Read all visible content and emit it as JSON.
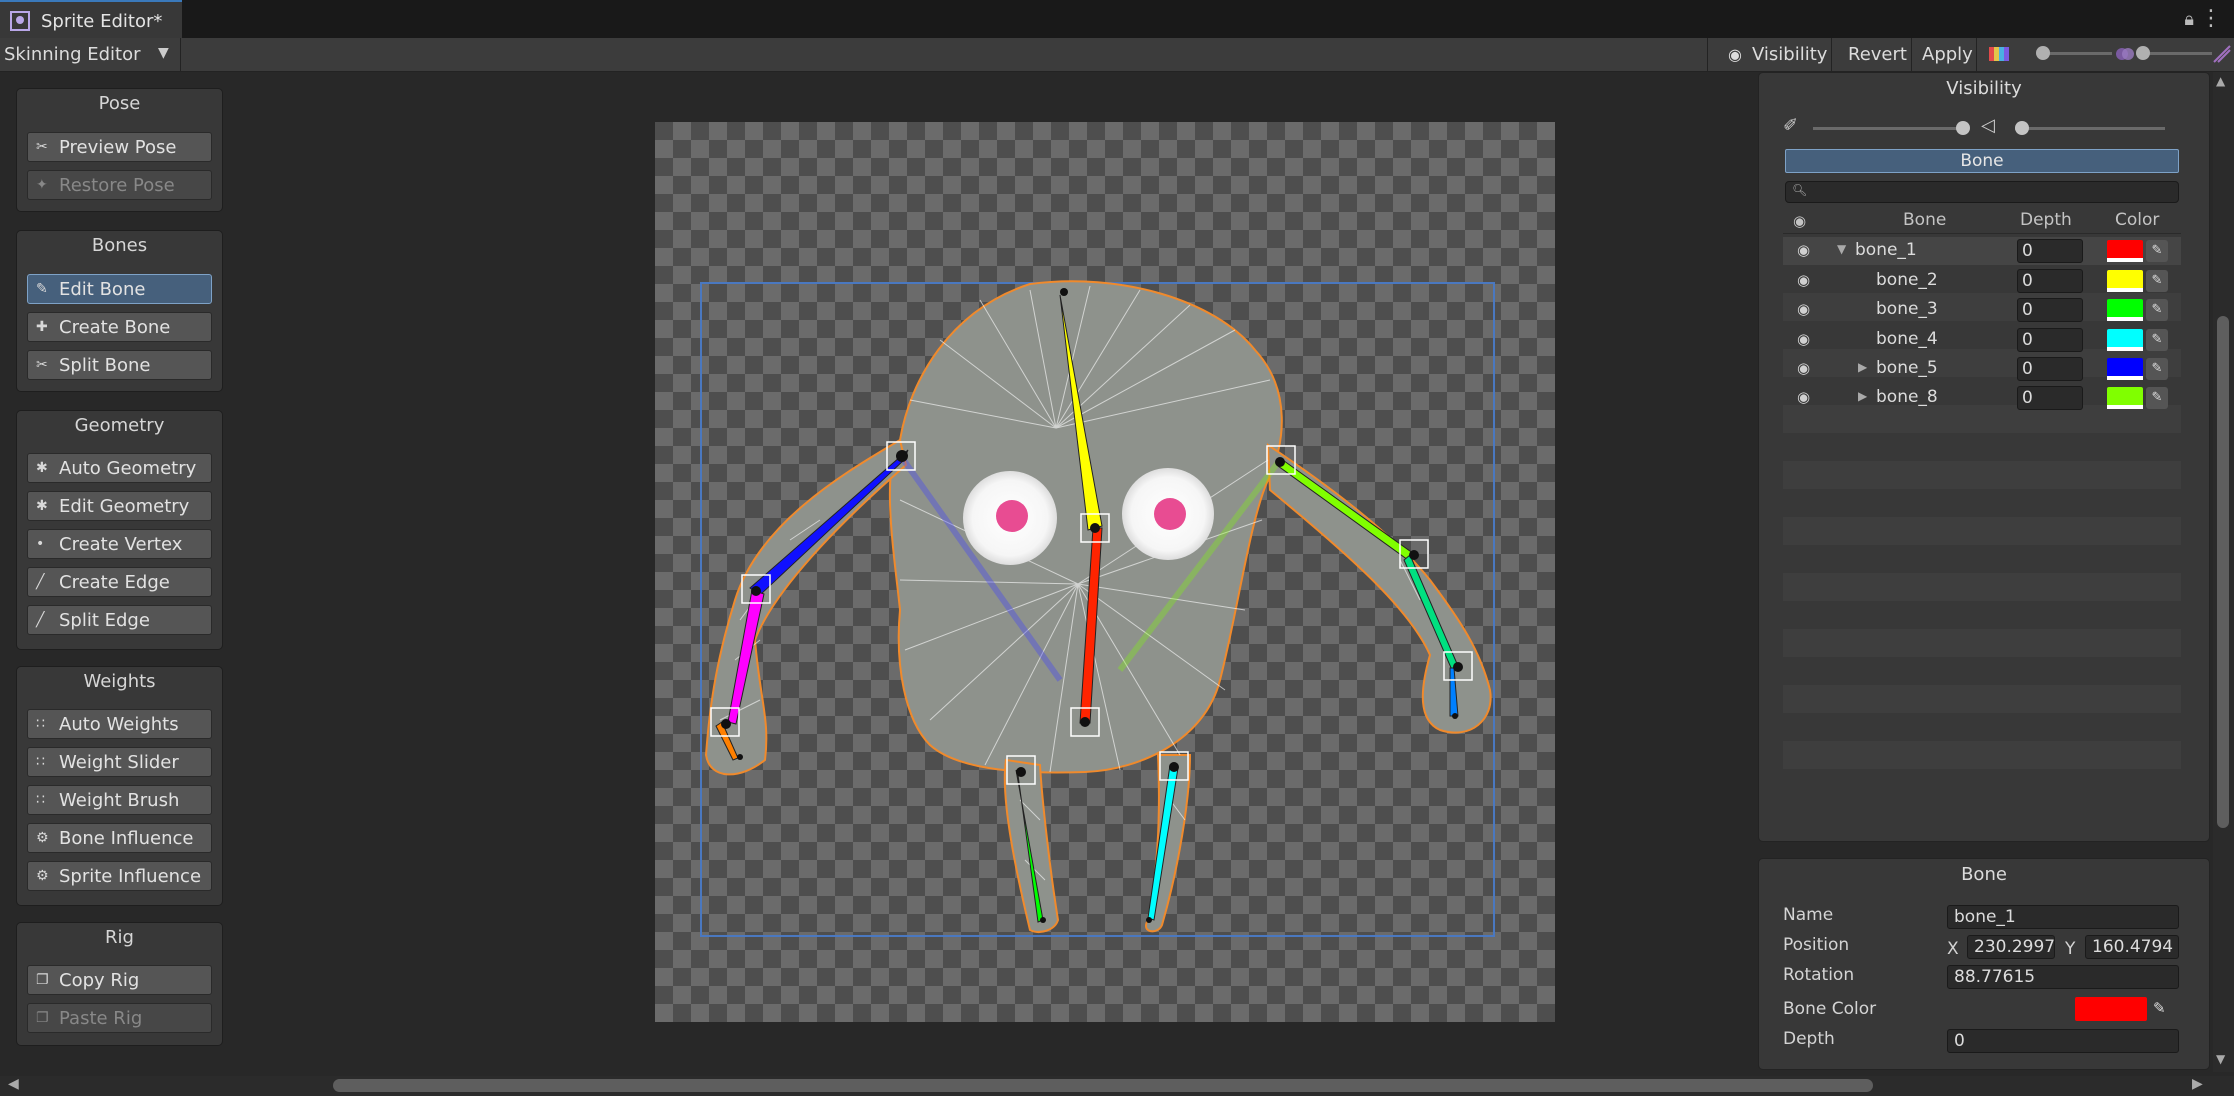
{
  "window": {
    "tab_title": "Sprite Editor*"
  },
  "toolbar": {
    "mode": "Skinning Editor",
    "visibility_label": "Visibility",
    "revert_label": "Revert",
    "apply_label": "Apply"
  },
  "tools": {
    "pose": {
      "title": "Pose",
      "preview": "Preview Pose",
      "restore": "Restore Pose"
    },
    "bones": {
      "title": "Bones",
      "edit": "Edit Bone",
      "create": "Create Bone",
      "split": "Split Bone"
    },
    "geometry": {
      "title": "Geometry",
      "auto": "Auto Geometry",
      "edit": "Edit Geometry",
      "create_vertex": "Create Vertex",
      "create_edge": "Create Edge",
      "split_edge": "Split Edge"
    },
    "weights": {
      "title": "Weights",
      "auto": "Auto Weights",
      "slider": "Weight Slider",
      "brush": "Weight Brush",
      "bone_influence": "Bone Influence",
      "sprite_influence": "Sprite Influence"
    },
    "rig": {
      "title": "Rig",
      "copy": "Copy Rig",
      "paste": "Paste Rig"
    }
  },
  "visibility": {
    "title": "Visibility",
    "tab": "Bone",
    "columns": {
      "bone": "Bone",
      "depth": "Depth",
      "color": "Color"
    },
    "bones": [
      {
        "name": "bone_1",
        "depth": "0",
        "color": "#ff0000",
        "expanded": true
      },
      {
        "name": "bone_2",
        "depth": "0",
        "color": "#ffff00"
      },
      {
        "name": "bone_3",
        "depth": "0",
        "color": "#00ff00"
      },
      {
        "name": "bone_4",
        "depth": "0",
        "color": "#00ffff"
      },
      {
        "name": "bone_5",
        "depth": "0",
        "color": "#0000ff",
        "expanded": false
      },
      {
        "name": "bone_8",
        "depth": "0",
        "color": "#80ff00",
        "expanded": false
      }
    ]
  },
  "inspector": {
    "title": "Bone",
    "name_label": "Name",
    "name_value": "bone_1",
    "position_label": "Position",
    "x_label": "X",
    "x_value": "230.2997",
    "y_label": "Y",
    "y_value": "160.4794",
    "rotation_label": "Rotation",
    "rotation_value": "88.77615",
    "color_label": "Bone Color",
    "color_value": "#ff0000",
    "depth_label": "Depth",
    "depth_value": "0"
  },
  "colors": {
    "accent": "#46607c",
    "sprite_outline": "#f08a2c",
    "selection_rect": "#4a78c0"
  }
}
